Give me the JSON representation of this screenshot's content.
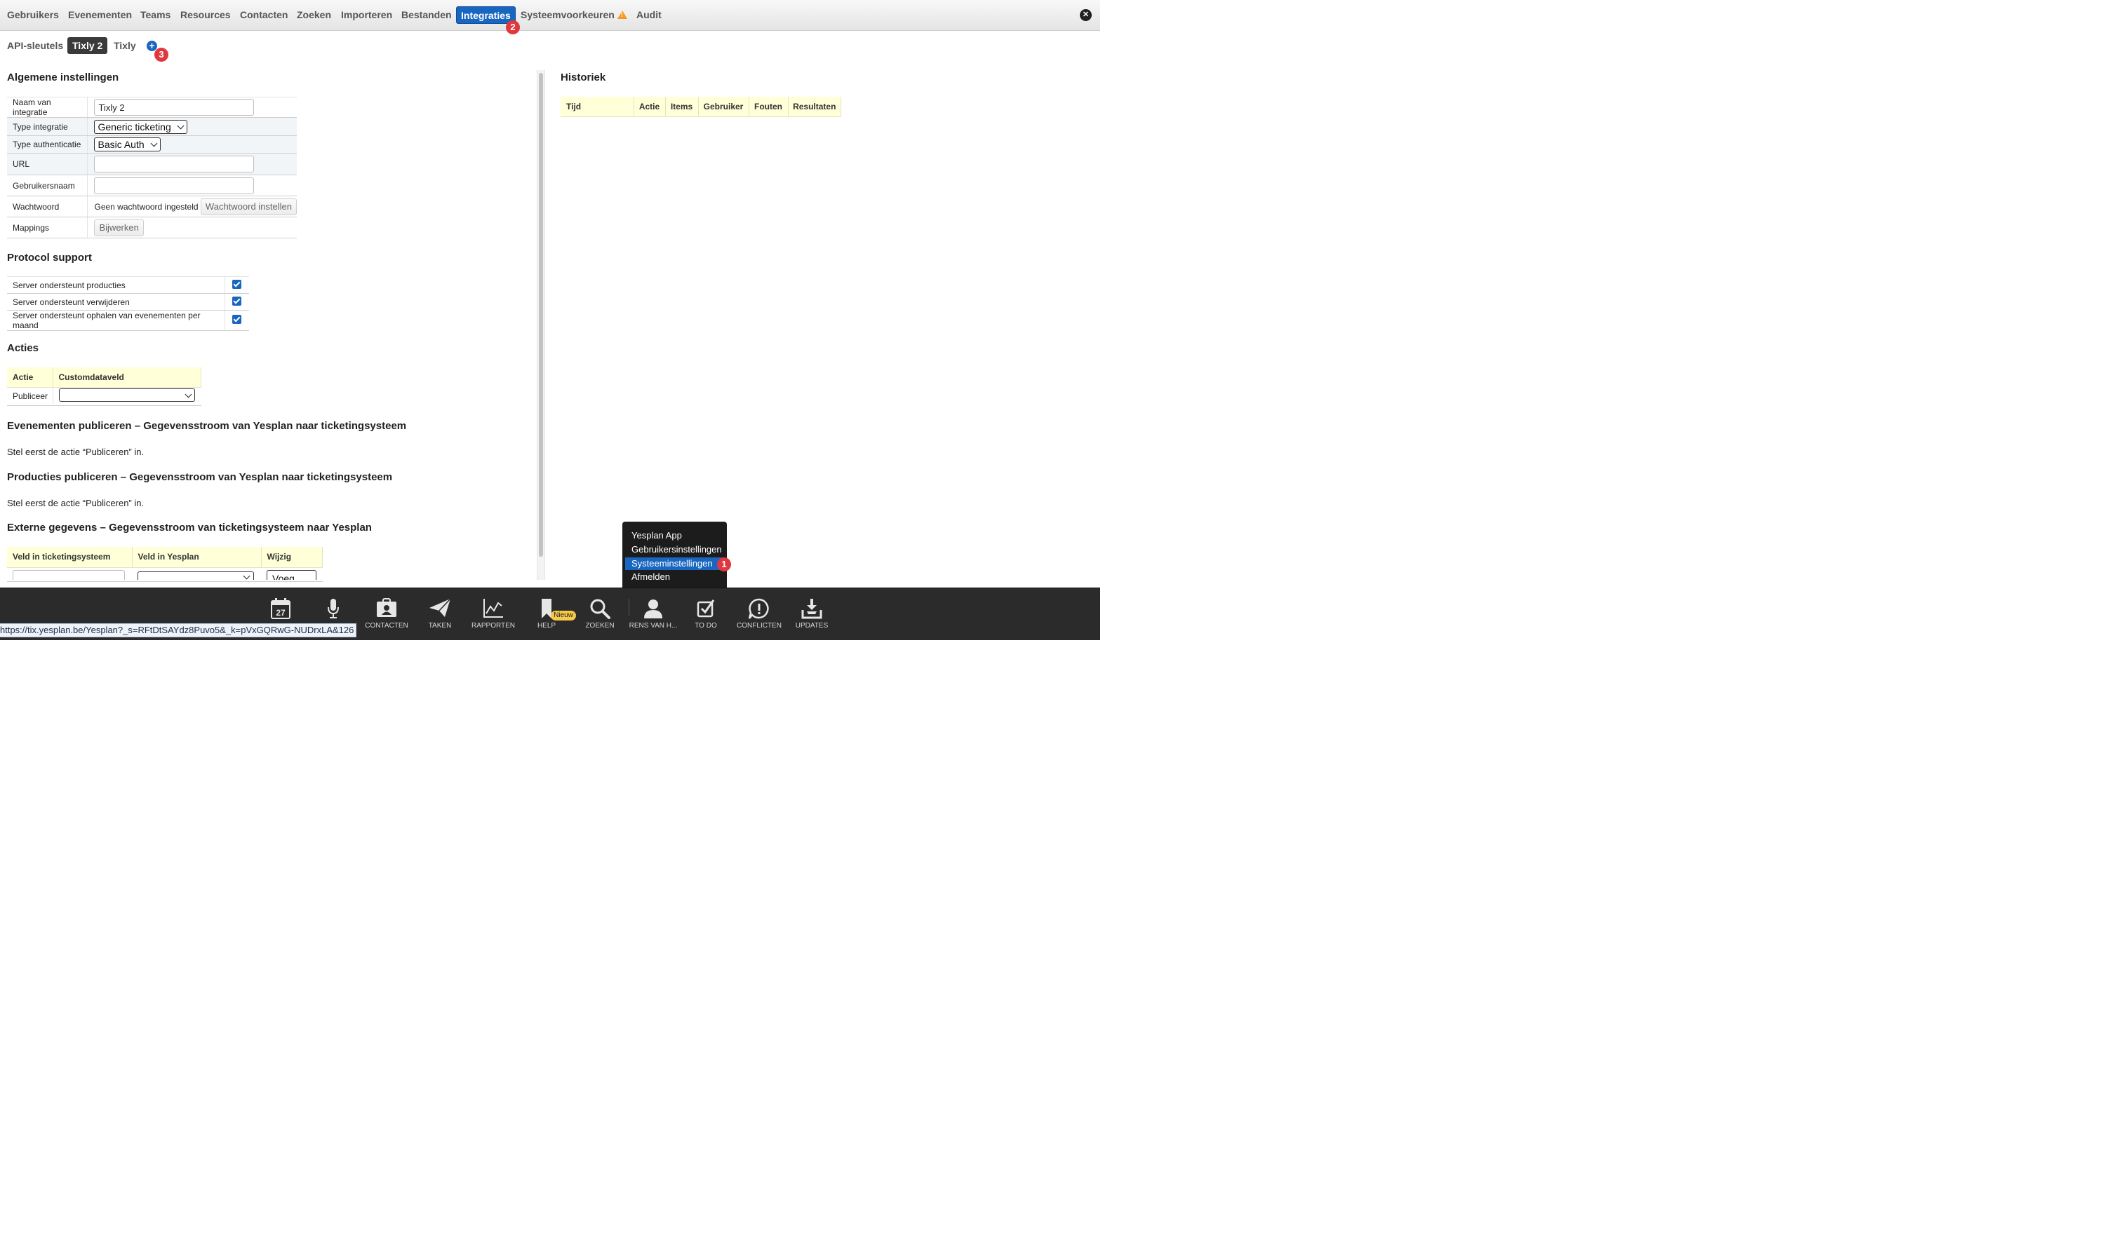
{
  "topnav": {
    "items": [
      "Gebruikers",
      "Evenementen",
      "Teams",
      "Resources",
      "Contacten",
      "Zoeken",
      "Importeren",
      "Bestanden",
      "Integraties",
      "Systeemvoorkeuren",
      "Audit"
    ],
    "active": "Integraties",
    "close_glyph": "✕"
  },
  "badges": {
    "one": "1",
    "two": "2",
    "three": "3"
  },
  "subtabs": {
    "items": [
      "API-sleutels",
      "Tixly 2",
      "Tixly"
    ],
    "active": "Tixly 2",
    "add_glyph": "+"
  },
  "general": {
    "title": "Algemene instellingen",
    "rows": {
      "name_label": "Naam van integratie",
      "name_value": "Tixly 2",
      "type_label": "Type integratie",
      "type_value": "Generic ticketing",
      "auth_label": "Type authenticatie",
      "auth_value": "Basic Auth",
      "url_label": "URL",
      "url_value": "",
      "user_label": "Gebruikersnaam",
      "user_value": "",
      "pw_label": "Wachtwoord",
      "pw_status": "Geen wachtwoord ingesteld",
      "pw_button": "Wachtwoord instellen",
      "map_label": "Mappings",
      "map_button": "Bijwerken"
    }
  },
  "protocol": {
    "title": "Protocol support",
    "rows": [
      "Server ondersteunt producties",
      "Server ondersteunt verwijderen",
      "Server ondersteunt ophalen van evenementen per maand"
    ],
    "checked": [
      true,
      true,
      true
    ]
  },
  "actions": {
    "title": "Acties",
    "col_action": "Actie",
    "col_field": "Customdataveld",
    "row_action": "Publiceer",
    "row_field": ""
  },
  "sections": {
    "events_title": "Evenementen publiceren – Gegevensstroom van Yesplan naar ticketingsysteem",
    "events_text": "Stel eerst de actie “Publiceren” in.",
    "productions_title": "Producties publiceren – Gegevensstroom van Yesplan naar ticketingsysteem",
    "productions_text": "Stel eerst de actie “Publiceren” in.",
    "external_title": "Externe gegevens – Gegevensstroom van ticketingsysteem naar Yesplan"
  },
  "external": {
    "col1": "Veld in ticketingsysteem",
    "col2": "Veld in Yesplan",
    "col3": "Wijzig",
    "add_button": "Voeg toe"
  },
  "history": {
    "title": "Historiek",
    "cols": [
      "Tijd",
      "Actie",
      "Items",
      "Gebruiker",
      "Fouten",
      "Resultaten"
    ]
  },
  "user_menu": {
    "items": [
      "Yesplan App",
      "Gebruikersinstellingen",
      "Systeeminstellingen",
      "Afmelden"
    ],
    "selected": "Systeeminstellingen"
  },
  "dock": {
    "calendar_day": "27",
    "items": [
      "",
      "",
      "CONTACTEN",
      "TAKEN",
      "RAPPORTEN",
      "HELP",
      "ZOEKEN",
      "RENS VAN H...",
      "TO DO",
      "CONFLICTEN",
      "UPDATES"
    ],
    "help_badge": "Nieuw"
  },
  "status_url": "https://tix.yesplan.be/Yesplan?_s=RFtDtSAYdz8Puvo5&_k=pVxGQRwG-NUDrxLA&126"
}
